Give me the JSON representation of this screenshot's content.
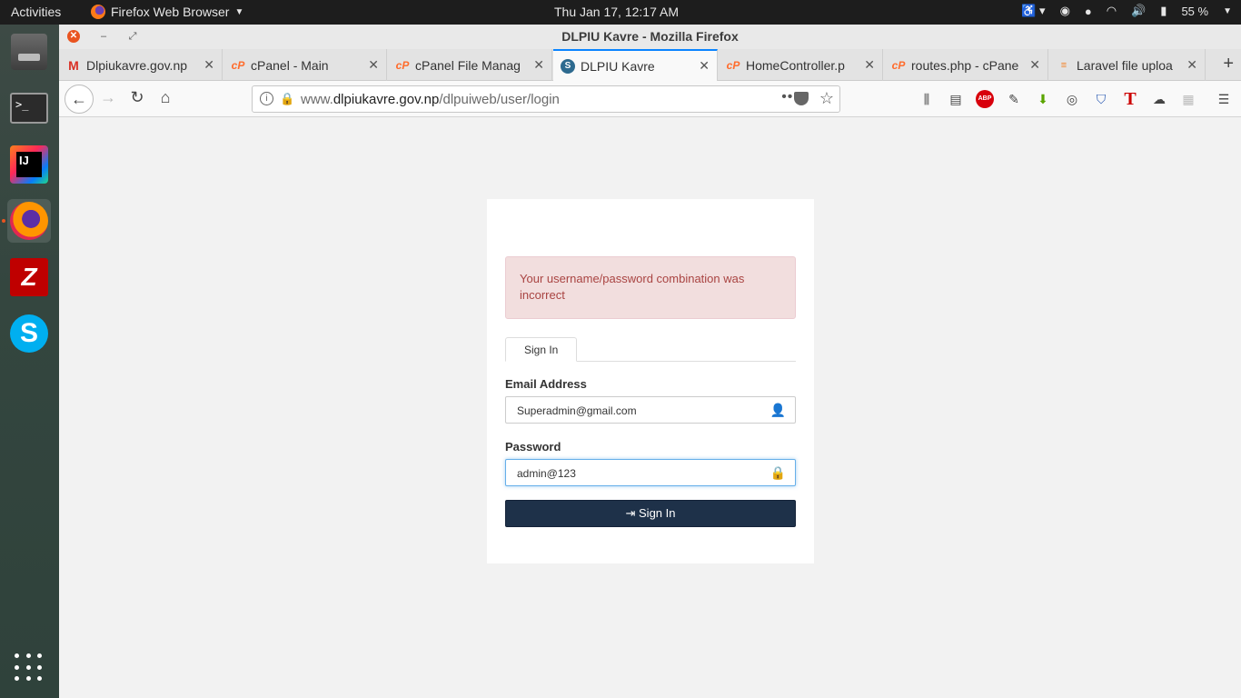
{
  "topbar": {
    "activities": "Activities",
    "app_name": "Firefox Web Browser",
    "clock": "Thu Jan 17, 12:17 AM",
    "battery": "55 %"
  },
  "dock": {
    "terminal_glyph": ">_",
    "intellij_label": "IJ",
    "filezilla_label": "Z",
    "skype_label": "S"
  },
  "window": {
    "title": "DLPIU Kavre - Mozilla Firefox"
  },
  "tabs": [
    {
      "label": "Dlpiukavre.gov.np",
      "icon": "gmail-icon"
    },
    {
      "label": "cPanel - Main",
      "icon": "cpanel-icon"
    },
    {
      "label": "cPanel File Manag",
      "icon": "cpanel-icon"
    },
    {
      "label": "DLPIU Kavre",
      "icon": "site-icon"
    },
    {
      "label": "HomeController.p",
      "icon": "cpanel-icon"
    },
    {
      "label": "routes.php - cPane",
      "icon": "cpanel-icon"
    },
    {
      "label": "Laravel file uploa",
      "icon": "stackoverflow-icon"
    }
  ],
  "navbar": {
    "url_prefix": "www.",
    "url_domain": "dlpiukavre.gov.np",
    "url_path": "/dlpuiweb/user/login",
    "page_actions": "•••"
  },
  "login": {
    "alert": "Your username/password combination was incorrect",
    "tab_label": "Sign In",
    "email_label": "Email Address",
    "email_value": "Superadmin@gmail.com",
    "password_label": "Password",
    "password_value": "admin@123",
    "button_label": "Sign In"
  }
}
